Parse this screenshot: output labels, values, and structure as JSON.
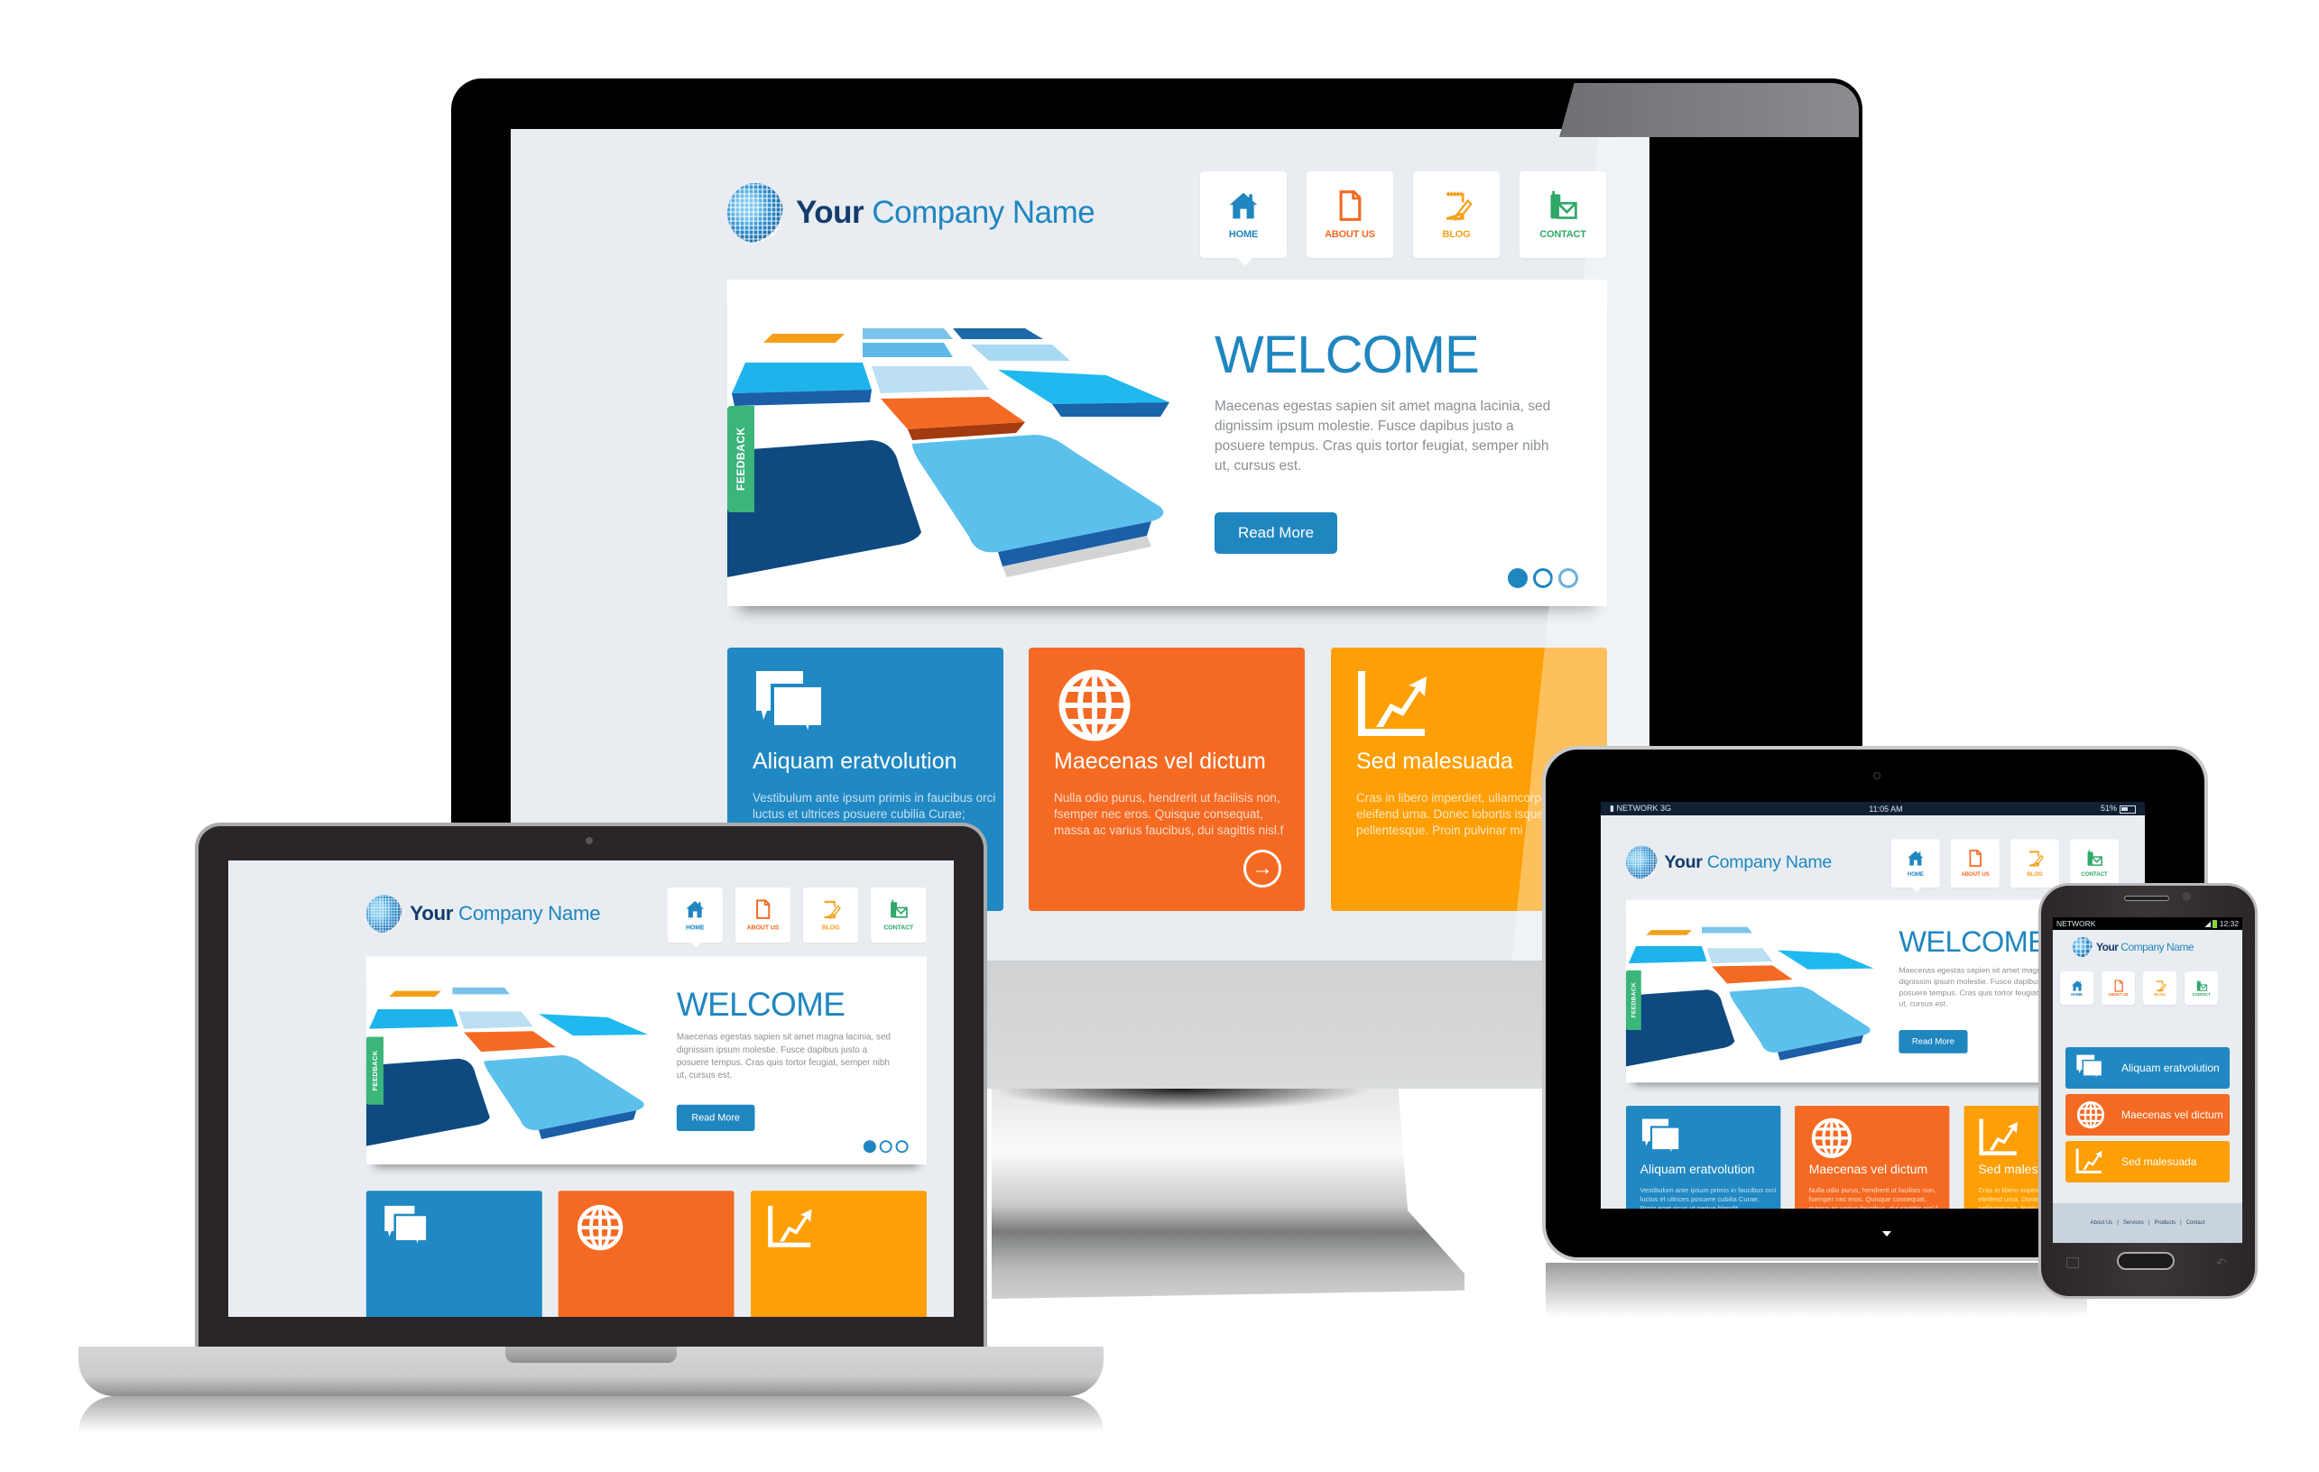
{
  "site": {
    "company_name_bold": "Your",
    "company_name_rest": " Company Name",
    "nav": [
      {
        "label": "HOME",
        "icon": "home-icon",
        "color": "#1f86c0"
      },
      {
        "label": "ABOUT US",
        "icon": "document-icon",
        "color": "#f26a22"
      },
      {
        "label": "BLOG",
        "icon": "notepad-pencil-icon",
        "color": "#f6a01a"
      },
      {
        "label": "CONTACT",
        "icon": "phone-mail-icon",
        "color": "#2fa868"
      }
    ],
    "feedback_label": "FEEDBACK",
    "hero": {
      "title": "WELCOME",
      "text": "Maecenas egestas sapien sit amet magna lacinia, sed dignissim ipsum molestie. Fusce dapibus justo a posuere tempus. Cras quis tortor feugiat, semper nibh ut, cursus est.",
      "button": "Read More",
      "slides_total": 3,
      "slide_active": 1
    },
    "tiles": [
      {
        "title": "Aliquam eratvolution",
        "text": "Vestibulum ante ipsum primis in faucibus orci luctus et ultrices posuere cubilia Curae; Proin eget risus ut neque blandit.",
        "icon": "chat-bubbles-icon",
        "color": "#2088c3"
      },
      {
        "title": "Maecenas vel dictum",
        "text": "Nulla odio purus, hendrerit ut facilisis non, fsemper nec eros. Quisque consequat, massa ac varius faucibus, dui sagittis nisl.f",
        "icon": "globe-icon",
        "color": "#f56a23"
      },
      {
        "title": "Sed malesuada",
        "text": "Cras in libero imperdiet, ullamcorper tempor, eleifend urna. Donec lobortis isque pellentesque. Proin pulvinar mi",
        "icon": "growth-chart-icon",
        "color": "#fd9f05"
      }
    ],
    "footer_links": [
      "About Us",
      "Services",
      "Products",
      "Contact"
    ]
  },
  "tablet_status": {
    "network": "NETWORK 3G",
    "time": "11:05 AM",
    "battery": "51%"
  },
  "phone_status": {
    "network": "NETWORK",
    "time": "12:32"
  },
  "colors": {
    "accent_blue": "#1f86c0",
    "navy": "#133b6b",
    "orange": "#f56a23",
    "amber": "#fd9f05",
    "green": "#3cb57a",
    "page_bg": "#e9edf1"
  }
}
